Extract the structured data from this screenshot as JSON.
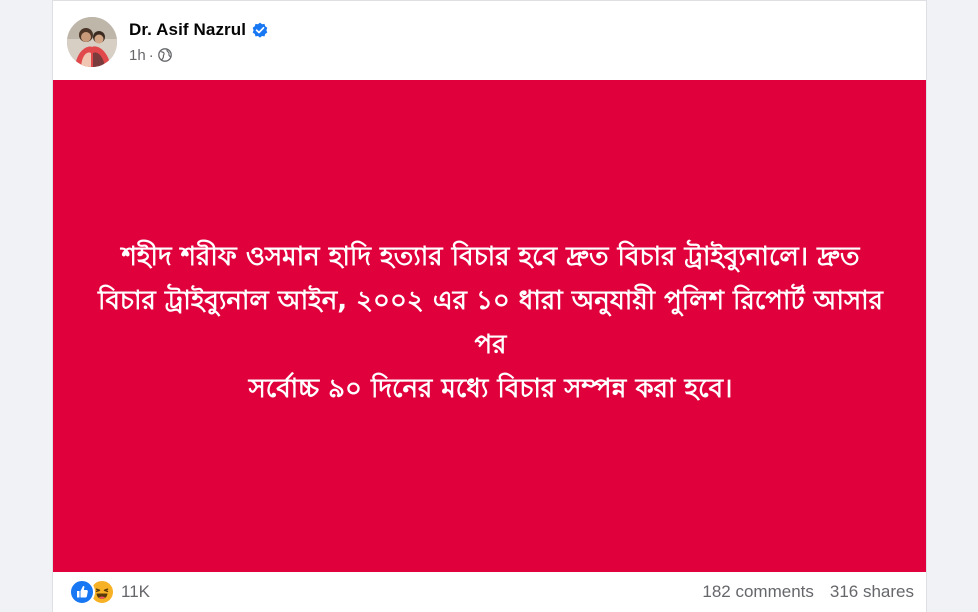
{
  "post": {
    "author": "Dr. Asif Nazrul",
    "time": "1h",
    "separator": "·",
    "audience_icon": "globe-icon",
    "verified_icon": "verified-badge-icon",
    "body_lines": [
      "শহীদ শরীফ ওসমান হাদি হত্যার বিচার হবে দ্রুত বিচার ট্রাইব্যুনালে। দ্রুত",
      "বিচার ট্রাইব্যুনাল আইন, ২০০২ এর ১০ ধারা অনুযায়ী পুলিশ রিপোর্ট আসার পর",
      "সর্বোচ্চ ৯০ দিনের মধ্যে বিচার সম্পন্ন করা হবে।"
    ],
    "background_color": "#e0003b"
  },
  "footer": {
    "reaction_icons": [
      "like-icon",
      "haha-icon"
    ],
    "reaction_count": "11K",
    "comments": "182 comments",
    "shares": "316 shares"
  },
  "colors": {
    "page_bg": "#f0f2f5",
    "card_bg": "#ffffff",
    "facebook_blue": "#1877f2",
    "secondary_text": "#65676b"
  }
}
